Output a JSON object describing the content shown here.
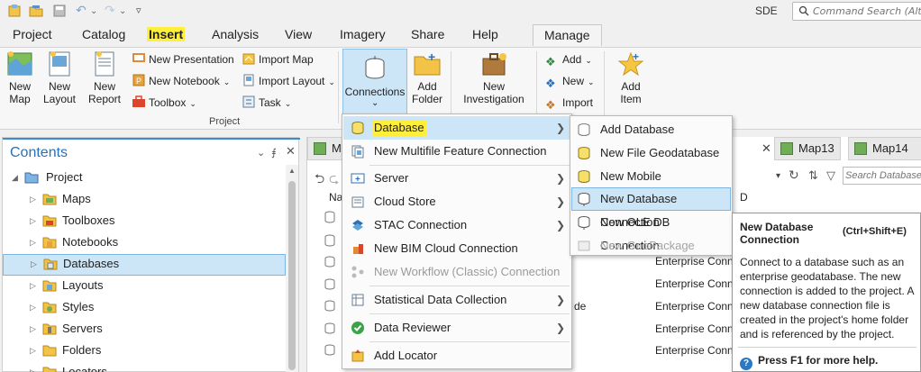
{
  "quick_access": {
    "user": "SDE"
  },
  "command_search": {
    "placeholder": "Command Search (Alt+Q)"
  },
  "tabs": [
    "Project",
    "Catalog",
    "Insert",
    "Analysis",
    "View",
    "Imagery",
    "Share",
    "Help",
    "Manage"
  ],
  "ribbon": {
    "new_map": "New\nMap",
    "new_layout": "New\nLayout",
    "new_report": "New\nReport",
    "new_presentation": "New Presentation",
    "new_notebook": "New Notebook",
    "toolbox": "Toolbox",
    "import_map": "Import Map",
    "import_layout": "Import Layout",
    "task": "Task",
    "project_group": "Project",
    "connections": "Connections",
    "add_folder": "Add\nFolder",
    "new_investigation": "New\nInvestigation",
    "add": "Add",
    "new": "New",
    "import": "Import",
    "add_item": "Add\nItem"
  },
  "contents": {
    "title": "Contents",
    "pin": "⨎",
    "close": "✕",
    "items": [
      {
        "label": "Project",
        "icon": "project-icon"
      },
      {
        "label": "Maps",
        "icon": "maps-folder-icon"
      },
      {
        "label": "Toolboxes",
        "icon": "toolboxes-folder-icon"
      },
      {
        "label": "Notebooks",
        "icon": "notebooks-folder-icon"
      },
      {
        "label": "Databases",
        "icon": "databases-folder-icon"
      },
      {
        "label": "Layouts",
        "icon": "layouts-folder-icon"
      },
      {
        "label": "Styles",
        "icon": "styles-folder-icon"
      },
      {
        "label": "Servers",
        "icon": "servers-folder-icon"
      },
      {
        "label": "Folders",
        "icon": "folders-folder-icon"
      },
      {
        "label": "Locators",
        "icon": "locators-folder-icon"
      }
    ]
  },
  "map_tabs": {
    "t1": "Ma",
    "t2": "Map13",
    "t3": "Map14"
  },
  "catalog": {
    "name_header": "Na",
    "type_header": "D",
    "search_placeholder": "Search Databases",
    "rows": [
      {
        "type": "Enterprise Conne"
      },
      {
        "type": "Enterprise Conne"
      },
      {
        "type": "Enterprise Conne"
      },
      {
        "type": "Enterprise Conne"
      },
      {
        "type": "Enterprise Conne"
      }
    ],
    "partial": "de"
  },
  "menu": {
    "database": "Database",
    "multifile": "New Multifile Feature Connection",
    "server": "Server",
    "cloud_store": "Cloud Store",
    "stac": "STAC Connection",
    "bim": "New BIM Cloud Connection",
    "workflow": "New Workflow (Classic) Connection",
    "statistical": "Statistical Data Collection",
    "data_reviewer": "Data Reviewer",
    "add_locator": "Add Locator"
  },
  "submenu": {
    "add_database": "Add Database",
    "file_gdb": "New File Geodatabase",
    "mobile_gdb": "New Mobile Geodatabase",
    "db_connection": "New Database Connection",
    "ole_db": "New OLE DB Connection",
    "geopackage": "New GeoPackage"
  },
  "tooltip": {
    "title": "New Database Connection",
    "shortcut": "(Ctrl+Shift+E)",
    "body": "Connect to a database such as an enterprise geodatabase. The new connection is added to the project. A new database connection file is created in the project's home folder and is referenced by the project.",
    "help": "Press F1 for more help."
  },
  "colors": {
    "accent": "#2a70b8",
    "highlight": "#cde6f7",
    "active_tab": "#ffef3a"
  }
}
